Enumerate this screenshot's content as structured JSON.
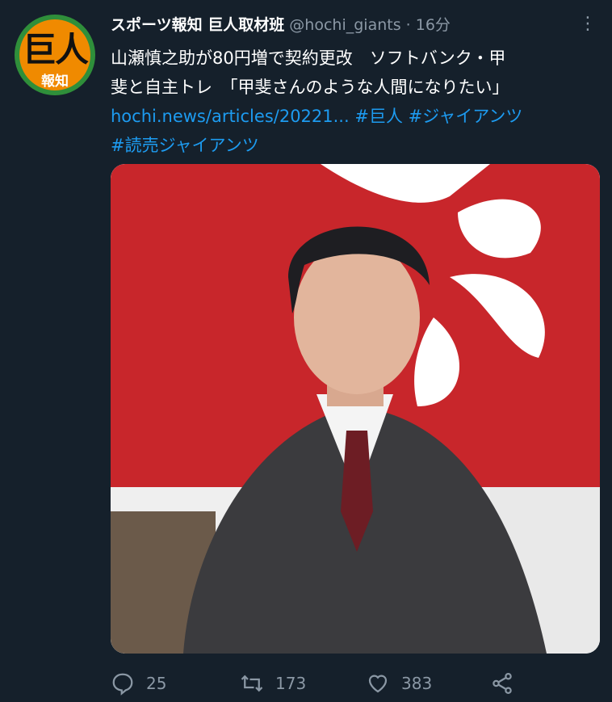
{
  "tweet": {
    "author_name": "スポーツ報知 巨人取材班",
    "handle": "@hochi_giants",
    "separator": "·",
    "time": "16分",
    "avatar_text": "巨人",
    "avatar_subtext": "報知",
    "text_lines": [
      "山瀬慎之助が80円増で契約更改　ソフトバンク・甲",
      "斐と自主トレ　「甲斐さんのような人間になりたい」"
    ],
    "link_text": "hochi.news/articles/20221...",
    "hashtags": [
      "#巨人",
      "#ジャイアンツ",
      "#読売ジャイアンツ"
    ]
  },
  "actions": {
    "replies": "25",
    "retweets": "173",
    "likes": "383"
  },
  "colors": {
    "background": "#15202b",
    "accent": "#1d9bf0",
    "muted": "#8b98a5",
    "banner_red": "#c8262b"
  },
  "icons": [
    "reply-icon",
    "retweet-icon",
    "like-icon",
    "share-icon",
    "more-icon"
  ]
}
